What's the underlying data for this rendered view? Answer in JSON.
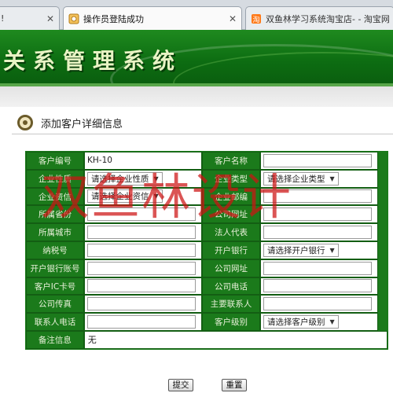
{
  "browser": {
    "tabs": [
      {
        "label": "!",
        "close": "✕"
      },
      {
        "label": "操作员登陆成功",
        "close": "✕"
      },
      {
        "label": "双鱼林学习系统淘宝店- - 淘宝网",
        "close": ""
      }
    ]
  },
  "header": {
    "title": "关系管理系统"
  },
  "section": {
    "title": "添加客户详细信息"
  },
  "form": {
    "rows": [
      {
        "l1": "客户编号",
        "v1": "KH-10",
        "l2": "客户名称"
      },
      {
        "l1": "企业性质",
        "s1": "请选择企业性质",
        "l2": "企业类型",
        "s2": "请选择企业类型"
      },
      {
        "l1": "企业资信",
        "s1": "请选择企业资信",
        "l2": "企业邮编"
      },
      {
        "l1": "所属省份",
        "l2": "公司网址"
      },
      {
        "l1": "所属城市",
        "l2": "法人代表"
      },
      {
        "l1": "纳税号",
        "l2": "开户银行",
        "s2": "请选择开户银行"
      },
      {
        "l1": "开户银行账号",
        "l2": "公司网址"
      },
      {
        "l1": "客户IC卡号",
        "l2": "公司电话"
      },
      {
        "l1": "公司传真",
        "l2": "主要联系人"
      },
      {
        "l1": "联系人电话",
        "l2": "客户级别",
        "s2": "请选择客户级别"
      }
    ],
    "remark": {
      "label": "备注信息",
      "value": "无"
    }
  },
  "buttons": {
    "submit": "提交",
    "reset": "重置"
  },
  "watermark": "双鱼林设计",
  "colors": {
    "banner_green": "#0d6d12",
    "table_green": "#1b7a1b",
    "watermark_red": "#cd1414"
  }
}
